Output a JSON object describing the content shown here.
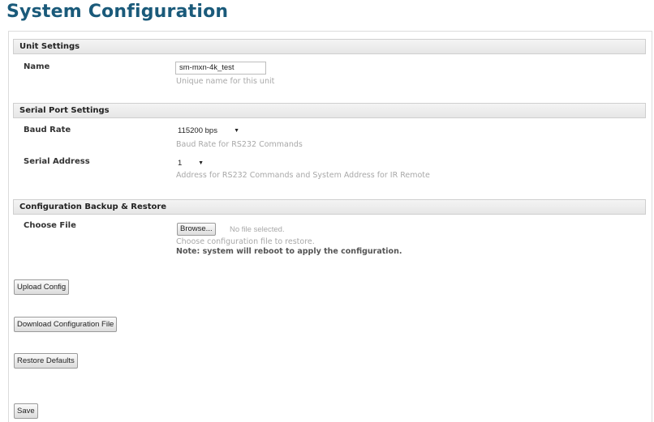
{
  "page": {
    "title": "System Configuration"
  },
  "unit_settings": {
    "header": "Unit Settings",
    "name_label": "Name",
    "name_value": "sm-mxn-4k_test",
    "name_hint": "Unique name for this unit"
  },
  "serial_port": {
    "header": "Serial Port Settings",
    "baud_label": "Baud Rate",
    "baud_value": "115200 bps",
    "baud_hint": "Baud Rate for RS232 Commands",
    "address_label": "Serial Address",
    "address_value": "1",
    "address_hint": "Address for RS232 Commands and System Address for IR Remote"
  },
  "backup_restore": {
    "header": "Configuration Backup & Restore",
    "file_label": "Choose File",
    "browse_label": "Browse...",
    "file_status": "No file selected.",
    "file_hint": "Choose configuration file to restore.",
    "note": "Note: system will reboot to apply the configuration."
  },
  "actions": {
    "upload_label": "Upload Config",
    "download_label": "Download Configuration File",
    "restore_label": "Restore Defaults",
    "save_label": "Save"
  }
}
